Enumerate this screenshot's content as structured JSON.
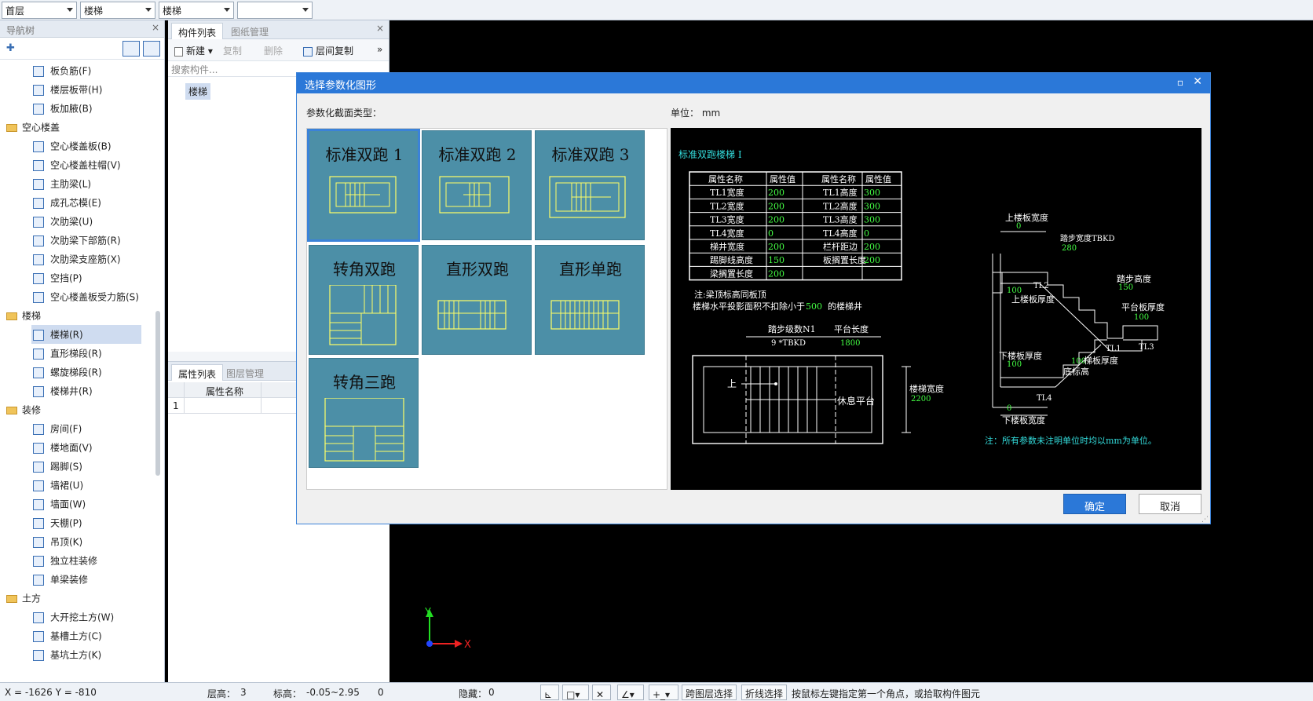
{
  "topbar": {
    "combos": [
      {
        "value": "首层"
      },
      {
        "value": "楼梯"
      },
      {
        "value": "楼梯"
      },
      {
        "value": ""
      }
    ]
  },
  "nav": {
    "title": "导航树",
    "tree": [
      {
        "label": "板负筋(F)",
        "type": "item"
      },
      {
        "label": "楼层板带(H)",
        "type": "item"
      },
      {
        "label": "板加腋(B)",
        "type": "item"
      },
      {
        "label": "空心楼盖",
        "type": "group"
      },
      {
        "label": "空心楼盖板(B)",
        "type": "item"
      },
      {
        "label": "空心楼盖柱帽(V)",
        "type": "item"
      },
      {
        "label": "主肋梁(L)",
        "type": "item"
      },
      {
        "label": "成孔芯模(E)",
        "type": "item"
      },
      {
        "label": "次肋梁(U)",
        "type": "item"
      },
      {
        "label": "次肋梁下部筋(R)",
        "type": "item"
      },
      {
        "label": "次肋梁支座筋(X)",
        "type": "item"
      },
      {
        "label": "空挡(P)",
        "type": "item"
      },
      {
        "label": "空心楼盖板受力筋(S)",
        "type": "item"
      },
      {
        "label": "楼梯",
        "type": "group"
      },
      {
        "label": "楼梯(R)",
        "type": "item",
        "selected": true
      },
      {
        "label": "直形梯段(R)",
        "type": "item"
      },
      {
        "label": "螺旋梯段(R)",
        "type": "item"
      },
      {
        "label": "楼梯井(R)",
        "type": "item"
      },
      {
        "label": "装修",
        "type": "group"
      },
      {
        "label": "房间(F)",
        "type": "item"
      },
      {
        "label": "楼地面(V)",
        "type": "item"
      },
      {
        "label": "踢脚(S)",
        "type": "item"
      },
      {
        "label": "墙裙(U)",
        "type": "item"
      },
      {
        "label": "墙面(W)",
        "type": "item"
      },
      {
        "label": "天棚(P)",
        "type": "item"
      },
      {
        "label": "吊顶(K)",
        "type": "item"
      },
      {
        "label": "独立柱装修",
        "type": "item"
      },
      {
        "label": "单梁装修",
        "type": "item"
      },
      {
        "label": "土方",
        "type": "group"
      },
      {
        "label": "大开挖土方(W)",
        "type": "item"
      },
      {
        "label": "基槽土方(C)",
        "type": "item"
      },
      {
        "label": "基坑土方(K)",
        "type": "item"
      }
    ]
  },
  "mid": {
    "tabs": [
      "构件列表",
      "图纸管理"
    ],
    "toolbar": {
      "new": "新建",
      "copy": "复制",
      "delete": "删除",
      "floor_copy": "层间复制"
    },
    "search_placeholder": "搜索构件...",
    "component": "楼梯",
    "prop_tabs": [
      "属性列表",
      "图层管理"
    ],
    "prop_header": "属性名称",
    "prop_row": "1"
  },
  "dialog": {
    "title": "选择参数化图形",
    "section_label": "参数化截面类型：",
    "unit_label": "单位： mm",
    "tiles": [
      "标准双跑 1",
      "标准双跑 2",
      "标准双跑 3",
      "转角双跑",
      "直形双跑",
      "直形单跑",
      "转角三跑"
    ],
    "ok": "确定",
    "cancel": "取消"
  },
  "preview": {
    "title": "标准双跑楼梯 I",
    "table": {
      "headers": [
        "属性名称",
        "属性值",
        "属性名称",
        "属性值"
      ],
      "rows": [
        [
          "TL1宽度",
          "200",
          "TL1高度",
          "300"
        ],
        [
          "TL2宽度",
          "200",
          "TL2高度",
          "300"
        ],
        [
          "TL3宽度",
          "200",
          "TL3高度",
          "300"
        ],
        [
          "TL4宽度",
          "0",
          "TL4高度",
          "0"
        ],
        [
          "梯井宽度",
          "200",
          "栏杆距边",
          "200"
        ],
        [
          "踢脚线高度",
          "150",
          "板搁置长度",
          "200"
        ],
        [
          "梁搁置长度",
          "200",
          "",
          ""
        ]
      ]
    },
    "note1": "注:梁顶标高同板顶",
    "note2_a": "楼梯水平投影面积不扣除小于",
    "note2_v": "500",
    "note2_b": "的楼梯井",
    "step_label": "踏步级数N1",
    "step_value": "9  *TBKD",
    "platform_label": "平台长度",
    "platform_value": "1800",
    "up": "上",
    "rest": "休息平台",
    "width_label": "楼梯宽度",
    "width_value": "2200",
    "sec_top_slab": "上楼板宽度",
    "sec_top_slab_v": "0",
    "sec_tread": "踏步宽度TBKD",
    "sec_tread_v": "280",
    "sec_riser": "踏步高度",
    "sec_riser_v": "150",
    "sec_tl2": "TL2",
    "sec_up_thick_v": "100",
    "sec_up_thick": "上楼板厚度",
    "sec_plat_thick": "平台板厚度",
    "sec_plat_thick_v": "100",
    "sec_tl1": "TL1",
    "sec_tl3": "TL3",
    "sec_low_thick": "下楼板厚度",
    "sec_low_thick_v": "100",
    "sec_stair_thick_v": "100",
    "sec_stair_thick": "梯板厚度",
    "sec_bottom": "底标高",
    "sec_tl4": "TL4",
    "sec_low_slab_v": "0",
    "sec_low_slab": "下楼板宽度",
    "foot_note": "注：所有参数未注明单位时均以mm为单位。"
  },
  "axis": {
    "x": "X",
    "y": "Y"
  },
  "status": {
    "coords": "X = -1626 Y = -810",
    "floor_h_label": "层高：",
    "floor_h": "3",
    "elev_label": "标高：",
    "elev": "-0.05~2.95",
    "zero": "0",
    "hidden_label": "隐藏：",
    "hidden": "0",
    "cross_select": "跨图层选择",
    "polyline_select": "折线选择",
    "hint": "按鼠标左键指定第一个角点，或拾取构件图元"
  },
  "colors": {
    "accent": "#2b78d8",
    "tile_bg": "#4c8fa7",
    "cad_yellow": "#ffff66",
    "cad_green": "#44ff44",
    "cad_cyan": "#33dddd"
  }
}
